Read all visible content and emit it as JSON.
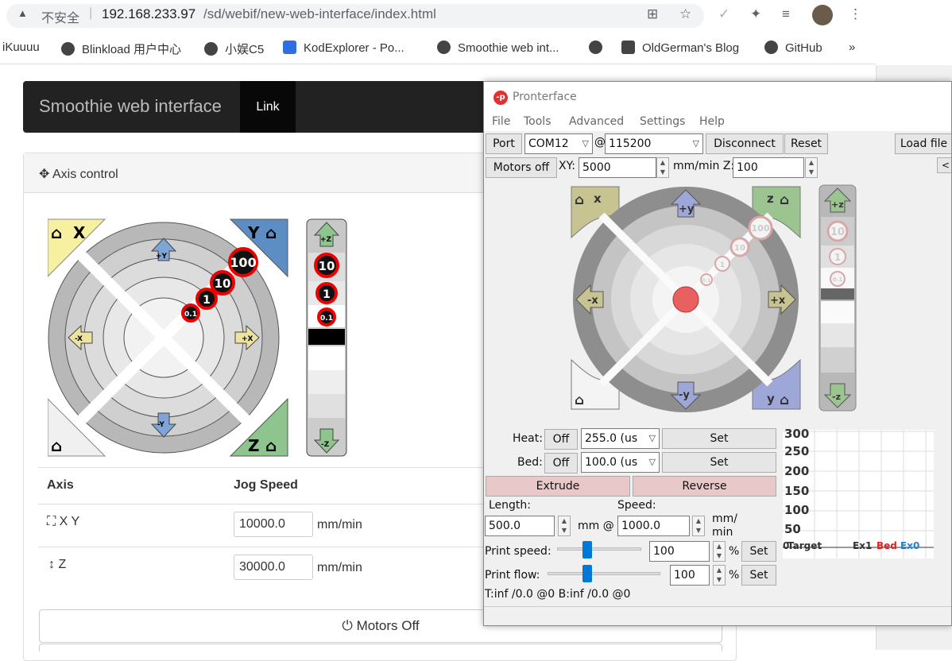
{
  "browser": {
    "security_warning": "不安全",
    "url_host": "192.168.233.97",
    "url_path": "/sd/webif/new-web-interface/index.html",
    "bookmarks": [
      "iKuuuu",
      "Blinkload 用户中心",
      "小娱C5",
      "KodExplorer - Po...",
      "Smoothie web int...",
      "",
      "OldGerman's Blog",
      "GitHub",
      "»"
    ]
  },
  "web": {
    "brand": "Smoothie web interface",
    "nav_link": "Link",
    "panel_title": "Axis control",
    "jog_labels": {
      "y_plus": "+Y",
      "y_minus": "-Y",
      "x_plus": "+X",
      "x_minus": "-X",
      "z_plus": "+Z",
      "z_minus": "-Z",
      "home_x": "X",
      "home_y": "Y",
      "home_z": "Z"
    },
    "steps": [
      "100",
      "10",
      "1",
      "0.1"
    ],
    "z_steps": [
      "10",
      "1",
      "0.1"
    ],
    "table": {
      "col_axis": "Axis",
      "col_speed": "Jog Speed",
      "rows": [
        {
          "axis": "X Y",
          "value": "10000.0",
          "unit": "mm/min"
        },
        {
          "axis": "Z",
          "value": "30000.0",
          "unit": "mm/min"
        }
      ]
    },
    "motors_off": "Motors Off"
  },
  "pronterface": {
    "title": "Pronterface",
    "logo": "-p",
    "menu": [
      "File",
      "Tools",
      "Advanced",
      "Settings",
      "Help"
    ],
    "port_label": "Port",
    "port_value": "COM12",
    "at": "@",
    "baud_value": "115200",
    "disconnect": "Disconnect",
    "reset": "Reset",
    "load_file": "Load file",
    "motors_off": "Motors off",
    "xy_label": "XY:",
    "xy_value": "5000",
    "mm_min_z": "mm/min Z:",
    "z_value": "100",
    "overflow_btn": "<",
    "heat_label": "Heat:",
    "heat_off": "Off",
    "heat_value": "255.0 (us",
    "set": "Set",
    "bed_label": "Bed:",
    "bed_off": "Off",
    "bed_value": "100.0 (us",
    "extrude": "Extrude",
    "reverse": "Reverse",
    "length_label": "Length:",
    "speed_label": "Speed:",
    "length_value": "500.0",
    "mm_at": "mm @",
    "speed_value": "1000.0",
    "mm_min_unit": "mm/ min",
    "print_speed_label": "Print speed:",
    "print_speed_value": "100",
    "print_flow_label": "Print flow:",
    "print_flow_value": "100",
    "percent": "%",
    "temps": "T:inf /0.0 @0 B:inf /0.0 @0",
    "jog_labels": {
      "y_plus": "+y",
      "y_minus": "-y",
      "x_plus": "+x",
      "x_minus": "-x",
      "z_plus": "+z",
      "z_minus": "-z",
      "home_x": "x",
      "home_z": "z",
      "home_y": "y"
    },
    "steps": [
      "100",
      "10",
      "1",
      "0.1"
    ],
    "z_steps": [
      "10",
      "1",
      "0.1"
    ],
    "graph": {
      "y_ticks": [
        "300",
        "250",
        "200",
        "150",
        "100",
        "50"
      ],
      "legend_target": "Target",
      "legend_ex1": "Ex1",
      "legend_bed": "Bed",
      "legend_ex0": "Ex0",
      "legend_prefix": "0"
    },
    "colors": {
      "bed": "#e02020",
      "ex0": "#2a7fd4"
    }
  }
}
